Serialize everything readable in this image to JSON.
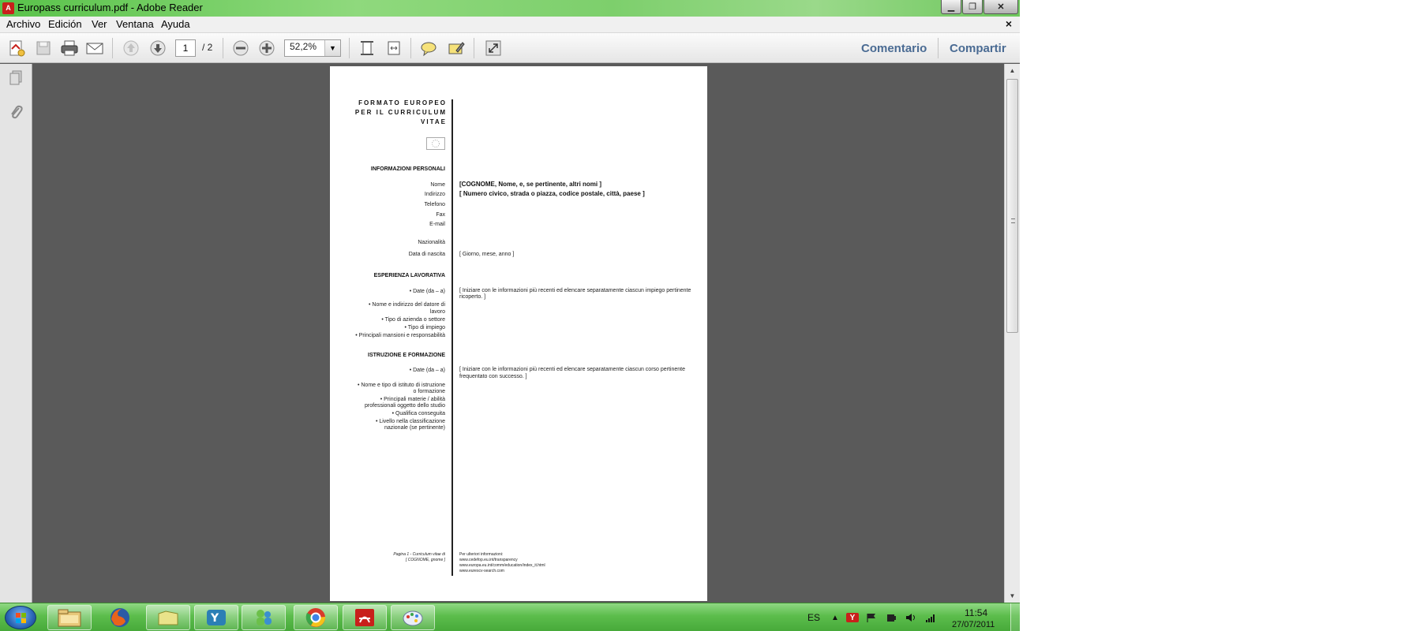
{
  "window": {
    "title": "Europass curriculum.pdf - Adobe Reader",
    "minimize_label": "▁",
    "maximize_label": "❐",
    "close_label": "✕"
  },
  "menu": {
    "items": [
      "Archivo",
      "Edición",
      "Ver",
      "Ventana",
      "Ayuda"
    ],
    "doc_close": "×"
  },
  "toolbar": {
    "page_current": "1",
    "page_total": "/ 2",
    "zoom": "52,2%",
    "comment_label": "Comentario",
    "share_label": "Compartir"
  },
  "document": {
    "header_line1": "Formato europeo",
    "header_line2": "per il curriculum",
    "header_line3": "vitae",
    "sections": {
      "personal": "Informazioni personali",
      "work": "Esperienza lavorativa",
      "education": "Istruzione e formazione"
    },
    "personal_labels": {
      "nome": "Nome",
      "indirizzo": "Indirizzo",
      "telefono": "Telefono",
      "fax": "Fax",
      "email": "E-mail",
      "nazionalita": "Nazionalità",
      "data_nascita": "Data di nascita"
    },
    "personal_values": {
      "nome": "[COGNOME, Nome, e, se pertinente, altri nomi ]",
      "indirizzo": "[ Numero civico, strada o piazza, codice postale, città, paese ]",
      "data_nascita": "[ Giorno, mese, anno ]"
    },
    "work_labels": {
      "date": "• Date (da – a)",
      "datore1": "• Nome e indirizzo del datore di",
      "datore2": "lavoro",
      "azienda": "• Tipo di azienda o settore",
      "impiego": "• Tipo di impiego",
      "mansioni": "• Principali mansioni e responsabilità"
    },
    "work_value_1": "[ Iniziare con le informazioni più recenti ed elencare separatamente ciascun impiego pertinente",
    "work_value_2": "ricoperto. ]",
    "edu_labels": {
      "date": "• Date (da – a)",
      "istituto1": "• Nome e tipo di istituto di istruzione",
      "istituto2": "o formazione",
      "materie1": "• Principali materie / abilità",
      "materie2": "professionali oggetto dello studio",
      "qualifica": "• Qualifica conseguita",
      "livello1": "• Livello nella classificazione",
      "livello2": "nazionale (se pertinente)"
    },
    "edu_value_1": "[ Iniziare con le informazioni più recenti ed elencare separatamente ciascun corso pertinente",
    "edu_value_2": "frequentato con successo. ]",
    "footer_left_1": "Pagina 1 - Curriculum vitae di",
    "footer_left_2": "[ COGNOME, gnome ]",
    "footer_right": [
      "Per ulteriori informazioni:",
      "www.cedefop.eu.int/transparency",
      "www.europa.eu.int/comm/education/index_it.html",
      "www.eurescv-search.com"
    ]
  },
  "taskbar": {
    "language": "ES",
    "time": "11:54",
    "date": "27/07/2011"
  },
  "colors": {
    "accent_link": "#4a6b93",
    "taskbar_green": "#5cbd4c",
    "titlebar_green": "#7dcf6c",
    "doc_background": "#5a5a5a"
  }
}
